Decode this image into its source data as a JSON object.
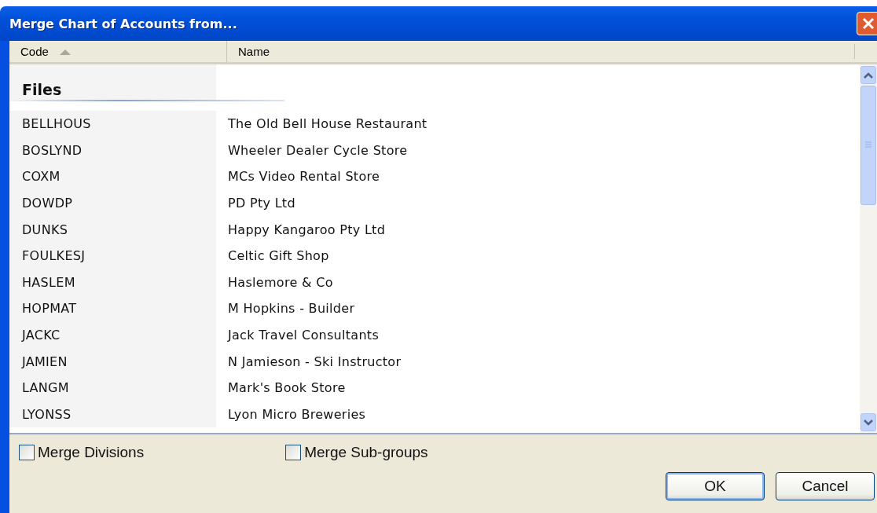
{
  "window": {
    "title": "Merge Chart of Accounts from..."
  },
  "table": {
    "columns": [
      {
        "label": "Code",
        "sorted": true
      },
      {
        "label": "Name",
        "sorted": false
      }
    ],
    "group": "Files",
    "rows": [
      {
        "code": "BELLHOUS",
        "name": "The Old Bell House Restaurant"
      },
      {
        "code": "BOSLYND",
        "name": "Wheeler Dealer Cycle Store"
      },
      {
        "code": "COXM",
        "name": "MCs Video Rental Store"
      },
      {
        "code": "DOWDP",
        "name": "PD Pty Ltd"
      },
      {
        "code": "DUNKS",
        "name": "Happy Kangaroo Pty Ltd"
      },
      {
        "code": "FOULKESJ",
        "name": "Celtic Gift Shop"
      },
      {
        "code": "HASLEM",
        "name": "Haslemore & Co"
      },
      {
        "code": "HOPMAT",
        "name": "M Hopkins - Builder"
      },
      {
        "code": "JACKC",
        "name": "Jack Travel Consultants"
      },
      {
        "code": "JAMIEN",
        "name": "N Jamieson - Ski Instructor"
      },
      {
        "code": "LANGM",
        "name": "Mark's Book Store"
      },
      {
        "code": "LYONSS",
        "name": "Lyon Micro Breweries"
      }
    ]
  },
  "options": [
    {
      "label": "Merge Divisions",
      "checked": false
    },
    {
      "label": "Merge Sub-groups",
      "checked": false
    }
  ],
  "buttons": [
    {
      "label": "OK",
      "default": true
    },
    {
      "label": "Cancel",
      "default": false
    }
  ]
}
